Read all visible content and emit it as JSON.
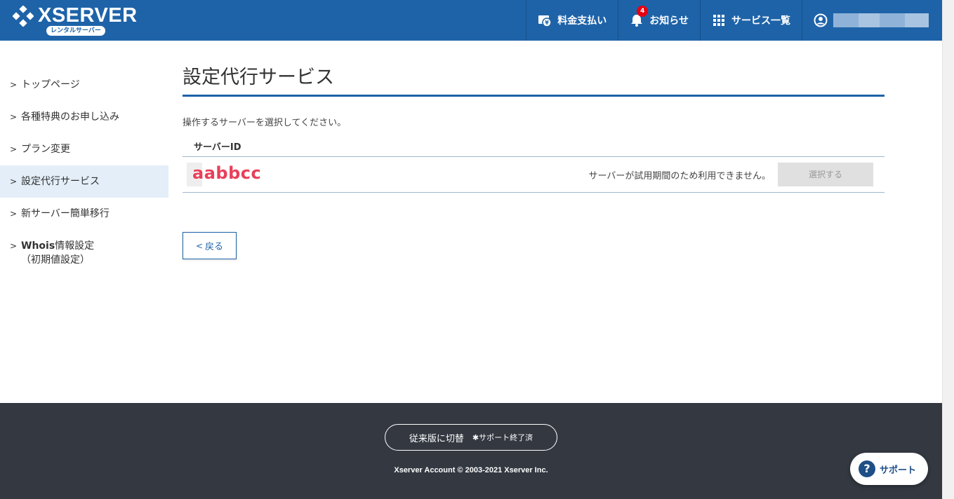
{
  "header": {
    "logo_text": "XSERVER",
    "logo_sub": "レンタルサーバー",
    "nav": {
      "billing": "料金支払い",
      "notifications": "お知らせ",
      "notifications_count": "4",
      "services": "サービス一覧"
    }
  },
  "sidebar": {
    "items": [
      {
        "label": "トップページ"
      },
      {
        "label": "各種特典のお申し込み"
      },
      {
        "label": "プラン変更"
      },
      {
        "label": "設定代行サービス"
      },
      {
        "label": "新サーバー簡単移行"
      },
      {
        "label_bold": "Whois",
        "label": "情報設定",
        "label2": "（初期値設定）"
      }
    ]
  },
  "main": {
    "title": "設定代行サービス",
    "instruction": "操作するサーバーを選択してください。",
    "table": {
      "header": "サーバーID",
      "rows": [
        {
          "server_id": "aabbcc",
          "message": "サーバーが試用期間のため利用できません。",
          "button": "選択する"
        }
      ]
    },
    "back_label": "戻る"
  },
  "footer": {
    "legacy_label": "従来版に切替",
    "legacy_note": "サポート終了済",
    "copyright": "Xserver Account © 2003-2021 Xserver Inc."
  },
  "support": {
    "label": "サポート"
  },
  "colors": {
    "brand": "#1e63a8",
    "footer": "#333841",
    "badge": "#e60012",
    "server_id": "#e8405a"
  }
}
